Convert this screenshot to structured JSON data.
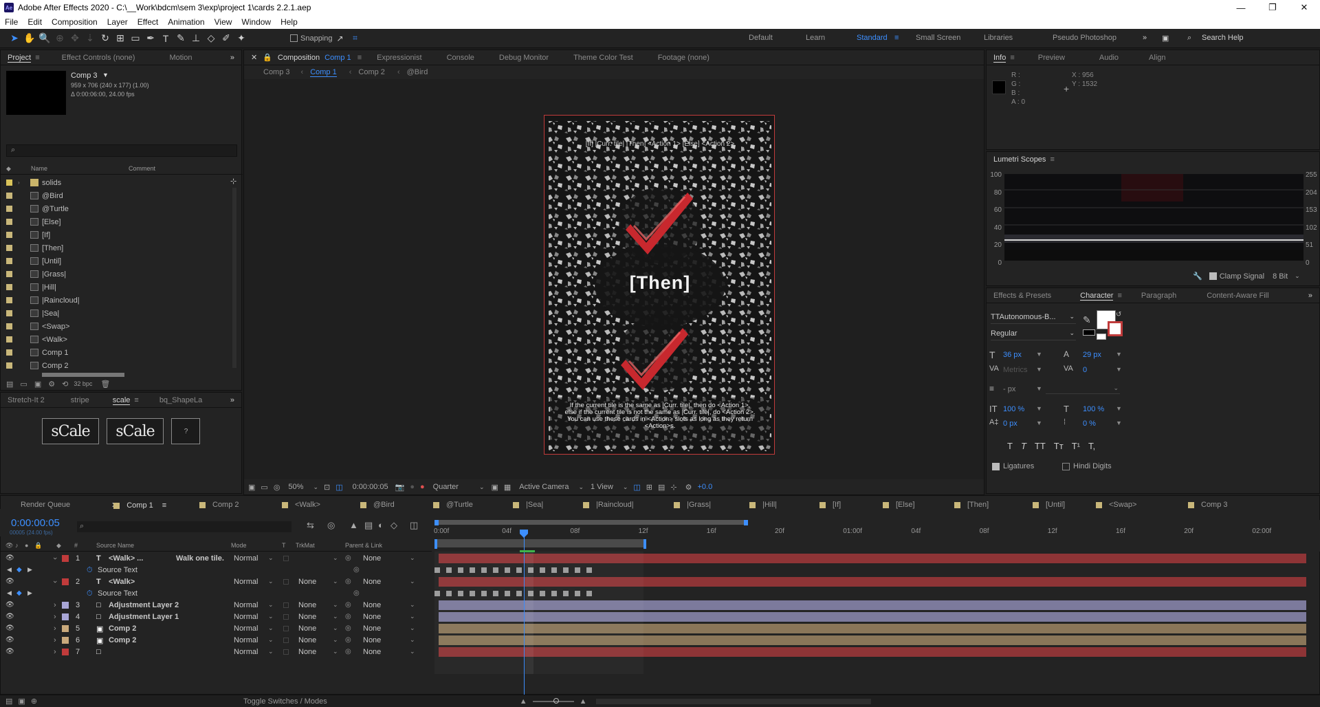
{
  "window": {
    "title": "Adobe After Effects 2020 - C:\\__Work\\bdcm\\sem 3\\exp\\project 1\\cards 2.2.1.aep",
    "app_icon": "Ae",
    "minimize": "—",
    "maximize": "❐",
    "close": "✕"
  },
  "menu": [
    "File",
    "Edit",
    "Composition",
    "Layer",
    "Effect",
    "Animation",
    "View",
    "Window",
    "Help"
  ],
  "toolbar": {
    "snapping_label": "Snapping",
    "workspaces": [
      "Default",
      "Learn",
      "Standard",
      "Small Screen",
      "Libraries",
      "Pseudo Photoshop"
    ],
    "active_workspace": "Standard",
    "search_placeholder": "Search Help"
  },
  "project_panel": {
    "tabs": [
      "Project",
      "Effect Controls (none)",
      "Motion"
    ],
    "selected_item": {
      "name": "Comp 3",
      "dimensions": "959 x 706  (240 x 177) (1.00)",
      "duration": "Δ 0:00:06:00, 24.00 fps"
    },
    "search_placeholder": "",
    "columns": [
      "Name",
      "Comment"
    ],
    "items": [
      {
        "name": "solids",
        "type": "folder",
        "color": "#d9c35a"
      },
      {
        "name": "@Bird",
        "type": "comp",
        "color": "#c9b77a"
      },
      {
        "name": "@Turtle",
        "type": "comp",
        "color": "#c9b77a"
      },
      {
        "name": "[Else]",
        "type": "comp",
        "color": "#c9b77a"
      },
      {
        "name": "[If]",
        "type": "comp",
        "color": "#c9b77a"
      },
      {
        "name": "[Then]",
        "type": "comp",
        "color": "#c9b77a"
      },
      {
        "name": "[Until]",
        "type": "comp",
        "color": "#c9b77a"
      },
      {
        "name": "|Grass|",
        "type": "comp",
        "color": "#c9b77a"
      },
      {
        "name": "|Hill|",
        "type": "comp",
        "color": "#c9b77a"
      },
      {
        "name": "|Raincloud|",
        "type": "comp",
        "color": "#c9b77a"
      },
      {
        "name": "|Sea|",
        "type": "comp",
        "color": "#c9b77a"
      },
      {
        "name": "<Swap>",
        "type": "comp",
        "color": "#c9b77a"
      },
      {
        "name": "<Walk>",
        "type": "comp",
        "color": "#c9b77a"
      },
      {
        "name": "Comp 1",
        "type": "comp",
        "color": "#c9b77a"
      },
      {
        "name": "Comp 2",
        "type": "comp",
        "color": "#c9b77a"
      }
    ],
    "bpc": "32 bpc"
  },
  "scripts_panel": {
    "tabs": [
      "Stretch-It 2",
      "stripe",
      "scale",
      "bq_ShapeLa"
    ],
    "buttons": [
      "sCale",
      "sCale",
      "?"
    ]
  },
  "comp_panel": {
    "tabs": [
      "Composition",
      "Expressionist",
      "Console",
      "Debug Monitor",
      "Theme Color Test",
      "Footage (none)"
    ],
    "active_comp": "Comp 1",
    "breadcrumbs": [
      "Comp 3",
      "Comp 1",
      "Comp 2",
      "@Bird"
    ],
    "canvas": {
      "top_text": "[If] |Curr. tile| [Then] <Action 1> [Else] <Action 2>",
      "center_text": "[Then]",
      "bottom_text": "If the current tile is the same as |Curr. tile|, then do <Action 1>, else if the current tile is not the same as |Curr. tile|, do <Action 2>. You can use these cards in <Action> slots as long as they return <Action>s."
    },
    "footer": {
      "zoom": "50%",
      "timecode": "0:00:00:05",
      "resolution": "Quarter",
      "camera": "Active Camera",
      "views": "1 View",
      "exposure": "+0.0"
    }
  },
  "info_panel": {
    "tabs": [
      "Info",
      "Preview",
      "Audio",
      "Align"
    ],
    "r": "R :",
    "g": "G :",
    "b": "B :",
    "a": "A :  0",
    "x": "X : 956",
    "y": "Y : 1532"
  },
  "lumetri": {
    "title": "Lumetri Scopes",
    "left_scale": [
      "100",
      "80",
      "60",
      "40",
      "20",
      "0"
    ],
    "right_scale": [
      "255",
      "204",
      "153",
      "102",
      "51",
      "0"
    ],
    "clamp_label": "Clamp Signal",
    "bit_depth": "8 Bit"
  },
  "character_panel": {
    "tabs": [
      "Effects & Presets",
      "Character",
      "Paragraph",
      "Content-Aware Fill"
    ],
    "font": "TTAutonomous-B...",
    "style": "Regular",
    "font_size": "36 px",
    "leading": "29 px",
    "kerning": "Metrics",
    "tracking": "0",
    "stroke_width": "- px",
    "vscale": "100 %",
    "hscale": "100 %",
    "baseline": "0 px",
    "tsume": "0 %",
    "ligatures_label": "Ligatures",
    "hindi_label": "Hindi Digits",
    "style_buttons": [
      "T",
      "T",
      "TT",
      "Tт",
      "T¹",
      "T,"
    ]
  },
  "timeline": {
    "tabs": [
      "Render Queue",
      "Comp 1",
      "Comp 2",
      "<Walk>",
      "@Bird",
      "@Turtle",
      "|Sea|",
      "|Raincloud|",
      "|Grass|",
      "|Hill|",
      "[If]",
      "[Else]",
      "[Then]",
      "[Until]",
      "<Swap>",
      "Comp 3"
    ],
    "active_tab": "Comp 1",
    "timecode": "0:00:00:05",
    "fps_note": "00005 (24.00 fps)",
    "columns": [
      "#",
      "Source Name",
      "Mode",
      "T",
      "TrkMat",
      "Parent & Link"
    ],
    "ruler": [
      "0:00f",
      "04f",
      "08f",
      "12f",
      "16f",
      "20f",
      "01:00f",
      "04f",
      "08f",
      "12f",
      "16f",
      "20f",
      "02:00f"
    ],
    "layers": [
      {
        "num": "1",
        "type": "T",
        "name": "<Walk> ...",
        "extra": "Walk one tile.",
        "mode": "Normal",
        "trkmat": "",
        "parent": "None",
        "color": "#c03b3b",
        "bar": "#8e3436",
        "expanded": true
      },
      {
        "num": "",
        "type": "prop",
        "name": "Source Text",
        "mode": "",
        "trkmat": "",
        "parent": "",
        "color": "",
        "bar": "keys"
      },
      {
        "num": "2",
        "type": "T",
        "name": "<Walk>",
        "extra": "",
        "mode": "Normal",
        "trkmat": "None",
        "parent": "None",
        "color": "#c03b3b",
        "bar": "#8e3436",
        "expanded": true
      },
      {
        "num": "",
        "type": "prop",
        "name": "Source Text",
        "mode": "",
        "trkmat": "",
        "parent": "",
        "color": "",
        "bar": "keys"
      },
      {
        "num": "3",
        "type": "adj",
        "name": "Adjustment Layer 2",
        "extra": "",
        "mode": "Normal",
        "trkmat": "None",
        "parent": "None",
        "color": "#a8a6d6",
        "bar": "#7c7a9c"
      },
      {
        "num": "4",
        "type": "adj",
        "name": "Adjustment Layer 1",
        "extra": "",
        "mode": "Normal",
        "trkmat": "None",
        "parent": "None",
        "color": "#a8a6d6",
        "bar": "#7c7a9c"
      },
      {
        "num": "5",
        "type": "comp",
        "name": "Comp 2",
        "extra": "",
        "mode": "Normal",
        "trkmat": "None",
        "parent": "None",
        "color": "#c9a97c",
        "bar": "#8a7659"
      },
      {
        "num": "6",
        "type": "comp",
        "name": "Comp 2",
        "extra": "",
        "mode": "Normal",
        "trkmat": "None",
        "parent": "None",
        "color": "#c9a97c",
        "bar": "#8a7659"
      },
      {
        "num": "7",
        "type": "solid",
        "name": "",
        "extra": "",
        "mode": "Normal",
        "trkmat": "None",
        "parent": "None",
        "color": "#c03b3b",
        "bar": "#8e3436"
      }
    ],
    "footer_label": "Toggle Switches / Modes"
  }
}
